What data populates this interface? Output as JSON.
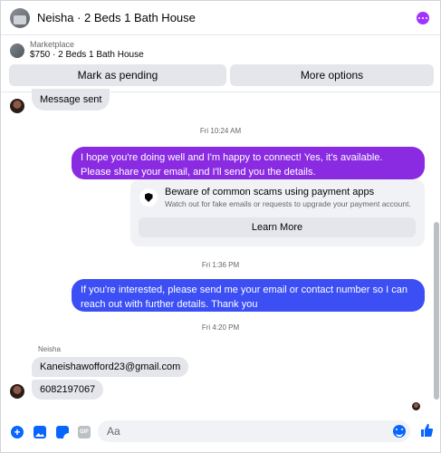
{
  "header": {
    "title": "Neisha · 2 Beds 1 Bath House",
    "thumb_icon": "listing-thumbnail",
    "menu_icon": "more-options-dots",
    "accent": "#a033ff"
  },
  "marketplace": {
    "label": "Marketplace",
    "listing": "$750 · 2 Beds 1 Bath House",
    "buttons": {
      "pending": "Mark as pending",
      "more": "More options"
    }
  },
  "messages": {
    "sent_notice": "Message sent",
    "stamp1": "Fri 10:24 AM",
    "out1": "I hope you're doing well and I'm happy to connect! Yes, it's available. Please share your email, and I'll send you the details.",
    "out1_color": "#8a2be2",
    "scam": {
      "title": "Beware of common scams using payment apps",
      "subtitle": "Watch out for fake emails or requests to upgrade your payment account.",
      "button": "Learn More"
    },
    "stamp2": "Fri 1:36 PM",
    "out2": "If you're interested, please send me your email or contact number so I can reach out with further details. Thank you",
    "out2_color": "#3b4ff5",
    "stamp3": "Fri 4:20 PM",
    "sender": "Neisha",
    "in1": "Kaneishawofford23@gmail.com",
    "in2": "6082197067"
  },
  "composer": {
    "placeholder": "Aa",
    "icons": [
      "plus-icon",
      "photo-icon",
      "sticker-icon",
      "gif-icon",
      "emoji-icon",
      "like-icon"
    ],
    "gif_label": "GIF",
    "accent": "#0866ff"
  }
}
